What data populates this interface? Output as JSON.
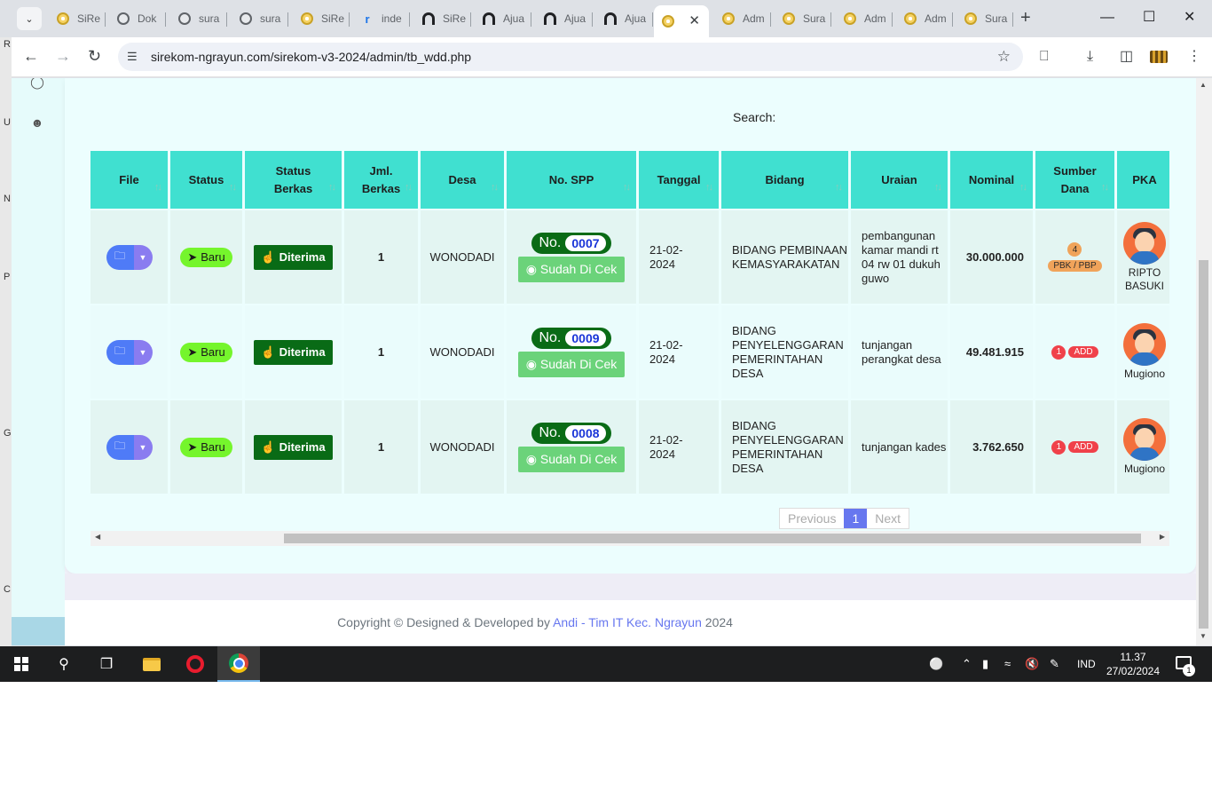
{
  "browser": {
    "tabs": [
      {
        "label": "SiRe",
        "icon": "sun-icon"
      },
      {
        "label": "Dok",
        "icon": "globe-icon"
      },
      {
        "label": "sura",
        "icon": "globe-icon"
      },
      {
        "label": "sura",
        "icon": "globe-icon"
      },
      {
        "label": "SiRe",
        "icon": "sun-icon"
      },
      {
        "label": "inde",
        "icon": "r-icon"
      },
      {
        "label": "SiRe",
        "icon": "arch-icon"
      },
      {
        "label": "Ajua",
        "icon": "arch-icon"
      },
      {
        "label": "Ajua",
        "icon": "arch-icon"
      },
      {
        "label": "Ajua",
        "icon": "arch-icon"
      },
      {
        "label": "",
        "icon": "sun-icon",
        "active": true
      },
      {
        "label": "Adm",
        "icon": "sun-icon"
      },
      {
        "label": "Sura",
        "icon": "sun-icon"
      },
      {
        "label": "Adm",
        "icon": "sun-icon"
      },
      {
        "label": "Adm",
        "icon": "sun-icon"
      },
      {
        "label": "Sura",
        "icon": "sun-icon"
      }
    ],
    "close_tab_glyph": "✕",
    "new_tab_glyph": "+",
    "url": "sirekom-ngrayun.com/sirekom-v3-2024/admin/tb_wdd.php",
    "left_edge_letters": [
      "R",
      "U",
      "N",
      "P",
      "G",
      "C"
    ]
  },
  "page": {
    "search_label": "Search:",
    "table": {
      "headers": [
        "File",
        "Status",
        "Status Berkas",
        "Jml. Berkas",
        "Desa",
        "No. SPP",
        "Tanggal",
        "Bidang",
        "Uraian",
        "Nominal",
        "Sumber Dana",
        "PKA"
      ],
      "rows": [
        {
          "status": "Baru",
          "status_berkas": "Diterima",
          "jml_berkas": "1",
          "desa": "WONODADI",
          "spp_prefix": "No.",
          "spp_number": "0007",
          "spp_check": "Sudah Di Cek",
          "tanggal": "21-02-2024",
          "bidang": "BIDANG PEMBINAAN KEMASYARAKATAN",
          "uraian": "pembangunan kamar mandi rt 04 rw 01 dukuh guwo",
          "nominal": "30.000.000",
          "sumber_count": "4",
          "sumber_label": "PBK / PBP",
          "sumber_color": "orange",
          "pka": "RIPTO BASUKI"
        },
        {
          "status": "Baru",
          "status_berkas": "Diterima",
          "jml_berkas": "1",
          "desa": "WONODADI",
          "spp_prefix": "No.",
          "spp_number": "0009",
          "spp_check": "Sudah Di Cek",
          "tanggal": "21-02-2024",
          "bidang": "BIDANG PENYELENGGARAN PEMERINTAHAN DESA",
          "uraian": "tunjangan perangkat desa",
          "nominal": "49.481.915",
          "sumber_count": "1",
          "sumber_label": "ADD",
          "sumber_color": "red",
          "pka": "Mugiono"
        },
        {
          "status": "Baru",
          "status_berkas": "Diterima",
          "jml_berkas": "1",
          "desa": "WONODADI",
          "spp_prefix": "No.",
          "spp_number": "0008",
          "spp_check": "Sudah Di Cek",
          "tanggal": "21-02-2024",
          "bidang": "BIDANG PENYELENGGARAN PEMERINTAHAN DESA",
          "uraian": "tunjangan kades",
          "nominal": "3.762.650",
          "sumber_count": "1",
          "sumber_label": "ADD",
          "sumber_color": "red",
          "pka": "Mugiono"
        }
      ]
    },
    "pagination": {
      "previous": "Previous",
      "current": "1",
      "next": "Next"
    },
    "footer": {
      "prefix": "Copyright © Designed & Developed by ",
      "link": "Andi - Tim IT Kec. Ngrayun",
      "year": " 2024"
    }
  },
  "taskbar": {
    "language": "IND",
    "time": "11.37",
    "date": "27/02/2024",
    "notification_count": "1"
  },
  "colors": {
    "header_bg": "#40e0d0",
    "accent": "#6777ef",
    "diterima": "#096b16",
    "baru": "#75f52c"
  }
}
